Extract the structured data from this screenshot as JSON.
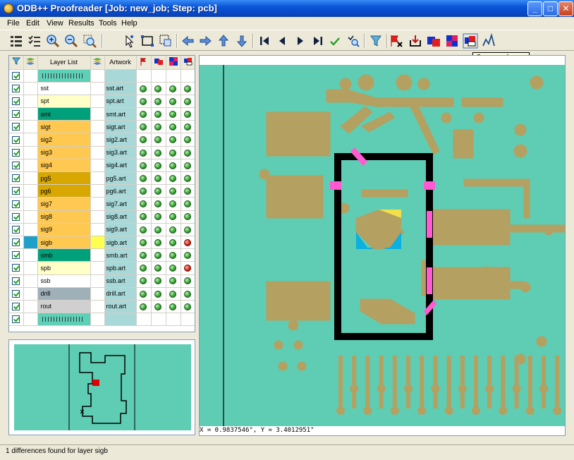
{
  "window": {
    "title": "ODB++ Proofreader [Job: new_job; Step: pcb]",
    "minimize_glyph": "_",
    "maximize_glyph": "□",
    "close_glyph": "✕"
  },
  "menu": [
    "File",
    "Edit",
    "View",
    "Results",
    "Tools",
    "Help"
  ],
  "toolbar": {
    "buttons": [
      "layer-list-icon",
      "checklist-icon",
      "zoom-in-icon",
      "zoom-out-icon",
      "zoom-fit-icon",
      "select-pointer-icon",
      "select-box-icon",
      "zoom-area-icon",
      "back-arrow-icon",
      "forward-arrow-icon",
      "up-arrow-icon",
      "down-arrow-icon",
      "first-icon",
      "previous-icon",
      "next-icon",
      "last-icon",
      "check-icon",
      "find-icon",
      "filter-icon",
      "clear-differences-icon",
      "export-icon",
      "compare-artwork-icon",
      "compare-puzzle-icon",
      "compare-layers-icon",
      "graph-icon"
    ],
    "tooltip": "Compare layers"
  },
  "layer_table": {
    "headers": {
      "layer_list": "Layer List",
      "artwork": "Artwork"
    },
    "rows": [
      {
        "name": "",
        "artwork": "",
        "color": "#5ed0b8",
        "pattern": true,
        "dots": []
      },
      {
        "name": "sst",
        "artwork": "sst.art",
        "color": "#ffffff",
        "dots": [
          "ok",
          "ok",
          "ok",
          "ok"
        ]
      },
      {
        "name": "spt",
        "artwork": "spt.art",
        "color": "#ffffc8",
        "dots": [
          "ok",
          "ok",
          "ok",
          "ok"
        ]
      },
      {
        "name": "smt",
        "artwork": "smt.art",
        "color": "#00a07a",
        "dots": [
          "ok",
          "ok",
          "ok",
          "ok"
        ]
      },
      {
        "name": "sigt",
        "artwork": "sigt.art",
        "color": "#ffc850",
        "dots": [
          "ok",
          "ok",
          "ok",
          "ok"
        ]
      },
      {
        "name": "sig2",
        "artwork": "sig2.art",
        "color": "#ffc850",
        "dots": [
          "ok",
          "ok",
          "ok",
          "ok"
        ]
      },
      {
        "name": "sig3",
        "artwork": "sig3.art",
        "color": "#ffc850",
        "dots": [
          "ok",
          "ok",
          "ok",
          "ok"
        ]
      },
      {
        "name": "sig4",
        "artwork": "sig4.art",
        "color": "#ffc850",
        "dots": [
          "ok",
          "ok",
          "ok",
          "ok"
        ]
      },
      {
        "name": "pg5",
        "artwork": "pg5.art",
        "color": "#d8a800",
        "dots": [
          "ok",
          "ok",
          "ok",
          "ok"
        ]
      },
      {
        "name": "pg6",
        "artwork": "pg6.art",
        "color": "#d8a800",
        "dots": [
          "ok",
          "ok",
          "ok",
          "ok"
        ]
      },
      {
        "name": "sig7",
        "artwork": "sig7.art",
        "color": "#ffc850",
        "dots": [
          "ok",
          "ok",
          "ok",
          "ok"
        ]
      },
      {
        "name": "sig8",
        "artwork": "sig8.art",
        "color": "#ffc850",
        "dots": [
          "ok",
          "ok",
          "ok",
          "ok"
        ]
      },
      {
        "name": "sig9",
        "artwork": "sig9.art",
        "color": "#ffc850",
        "dots": [
          "ok",
          "ok",
          "ok",
          "ok"
        ]
      },
      {
        "name": "sigb",
        "artwork": "sigb.art",
        "color": "#ffc850",
        "dots": [
          "ok",
          "ok",
          "ok",
          "diff"
        ],
        "selected": true
      },
      {
        "name": "smb",
        "artwork": "smb.art",
        "color": "#00a07a",
        "dots": [
          "ok",
          "ok",
          "ok",
          "ok"
        ]
      },
      {
        "name": "spb",
        "artwork": "spb.art",
        "color": "#ffffc8",
        "dots": [
          "ok",
          "ok",
          "ok",
          "diff"
        ]
      },
      {
        "name": "ssb",
        "artwork": "ssb.art",
        "color": "#ffffff",
        "dots": [
          "ok",
          "ok",
          "ok",
          "ok"
        ]
      },
      {
        "name": "drill",
        "artwork": "drill.art",
        "color": "#a0b0b8",
        "dots": [
          "ok",
          "ok",
          "ok",
          "ok"
        ]
      },
      {
        "name": "rout",
        "artwork": "rout.art",
        "color": "#d0d0d0",
        "dots": [
          "ok",
          "ok",
          "ok",
          "ok"
        ]
      },
      {
        "name": "",
        "artwork": "",
        "color": "#5ed0b8",
        "pattern": true,
        "dots": []
      }
    ]
  },
  "canvas": {
    "board_color": "#5ecdb3",
    "copper_color": "#b4a060",
    "outline_color": "#000000",
    "diff_color": "#ff5ad2"
  },
  "coordinates": "X = 0.9837546\", Y = 3.4012951\"",
  "status": "1 differences found for layer sigb"
}
